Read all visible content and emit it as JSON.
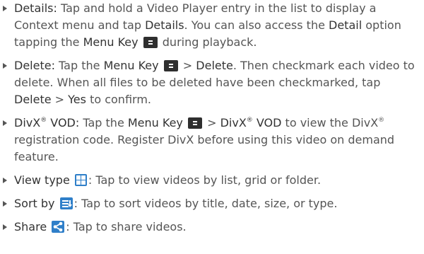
{
  "items": [
    {
      "term": "Details:",
      "t1": " Tap and hold a Video Player entry in the list to display a Context menu and tap ",
      "k1": "Details",
      "t2": ". You can also access the ",
      "k2": "Detail",
      "t3": " option tapping the ",
      "k3": "Menu Key",
      "t4": " during playback."
    },
    {
      "term": "Delete:",
      "t1": " Tap the ",
      "k1": "Menu Key",
      "t2": " > ",
      "k2": "Delete",
      "t3": ". Then checkmark each video to delete. When all files to be deleted have been checkmarked, tap ",
      "k3": "Delete",
      "t4": " > ",
      "k4": "Yes",
      "t5": " to confirm."
    },
    {
      "term": "DivX",
      "reg": "®",
      "term2": " VOD:",
      "t1": " Tap the ",
      "k1": "Menu Key",
      "t2": " > ",
      "k2": "DivX",
      "k2reg": "®",
      "k2b": " VOD",
      "t3": " to view the DivX",
      "t3reg": "®",
      "t4": " registration code. Register DivX before using this video on demand feature."
    },
    {
      "term": "View type",
      "t1": ": Tap to view videos by list, grid or folder."
    },
    {
      "term": "Sort by",
      "t1": ": Tap to sort videos by title, date, size, or type."
    },
    {
      "term": "Share",
      "t1": ": Tap to share videos."
    }
  ],
  "icons": {
    "menu_key": "menu-key-icon",
    "view_type": "view-type-icon",
    "sort_by": "sort-icon",
    "share": "share-icon"
  },
  "colors": {
    "text": "#555555",
    "emphasis": "#333333",
    "icon_blue": "#2f7fc9",
    "menu_key_bg": "#2f2f2f"
  }
}
